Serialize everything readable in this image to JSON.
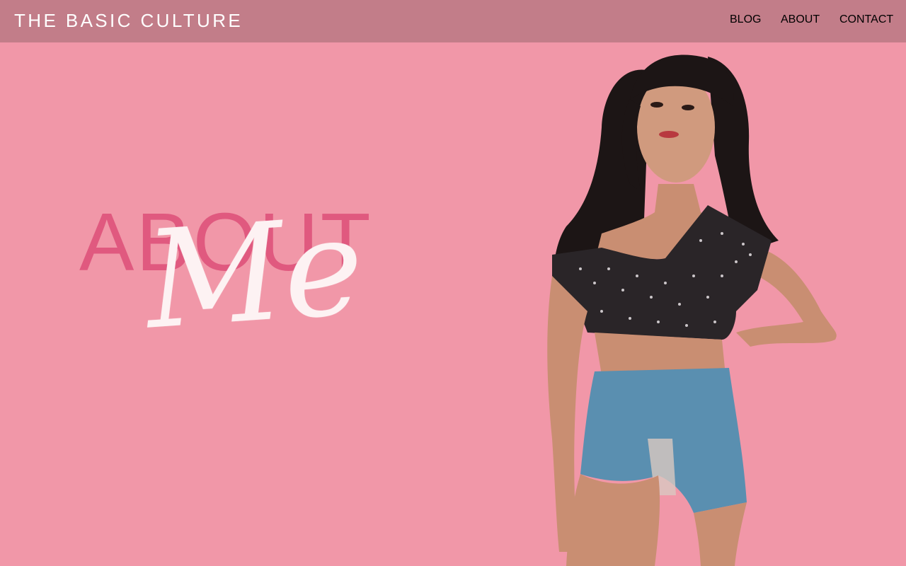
{
  "site": {
    "brand": "THE BASIC CULTURE"
  },
  "nav": {
    "items": [
      {
        "label": "BLOG"
      },
      {
        "label": "ABOUT"
      },
      {
        "label": "CONTACT"
      }
    ]
  },
  "hero": {
    "title": "ABOUT",
    "script": "Me"
  },
  "colors": {
    "page_background": "#f197a8",
    "header_background": "#c27d89",
    "title": "#e0597f",
    "script": "#fdf2f3"
  },
  "photo": {
    "icon": "model-portrait-image"
  }
}
